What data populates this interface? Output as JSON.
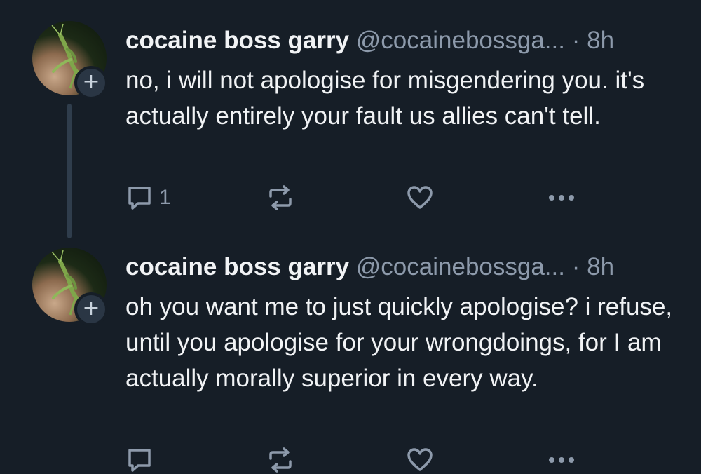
{
  "posts": [
    {
      "author_name": "cocaine boss garry",
      "handle": "@cocainebossga...",
      "separator": "·",
      "time": "8h",
      "text": "no, i will not apologise for misgendering you. it's actually entirely your fault us allies can't tell.",
      "reply_count": "1",
      "follow_symbol": "+"
    },
    {
      "author_name": "cocaine boss garry",
      "handle": "@cocainebossga...",
      "separator": "·",
      "time": "8h",
      "text": "oh you want me to just quickly apologise? i refuse, until you apologise for your wrongdoings, for I am actually morally superior in every way.",
      "reply_count": "",
      "follow_symbol": "+"
    }
  ],
  "icons": {
    "reply": "reply-icon",
    "repost": "repost-icon",
    "like": "heart-icon",
    "more": "more-icon"
  },
  "colors": {
    "background": "#161e27",
    "text": "#f1f3f5",
    "muted": "#8d9aab",
    "thread_line": "#2f3d4c"
  }
}
